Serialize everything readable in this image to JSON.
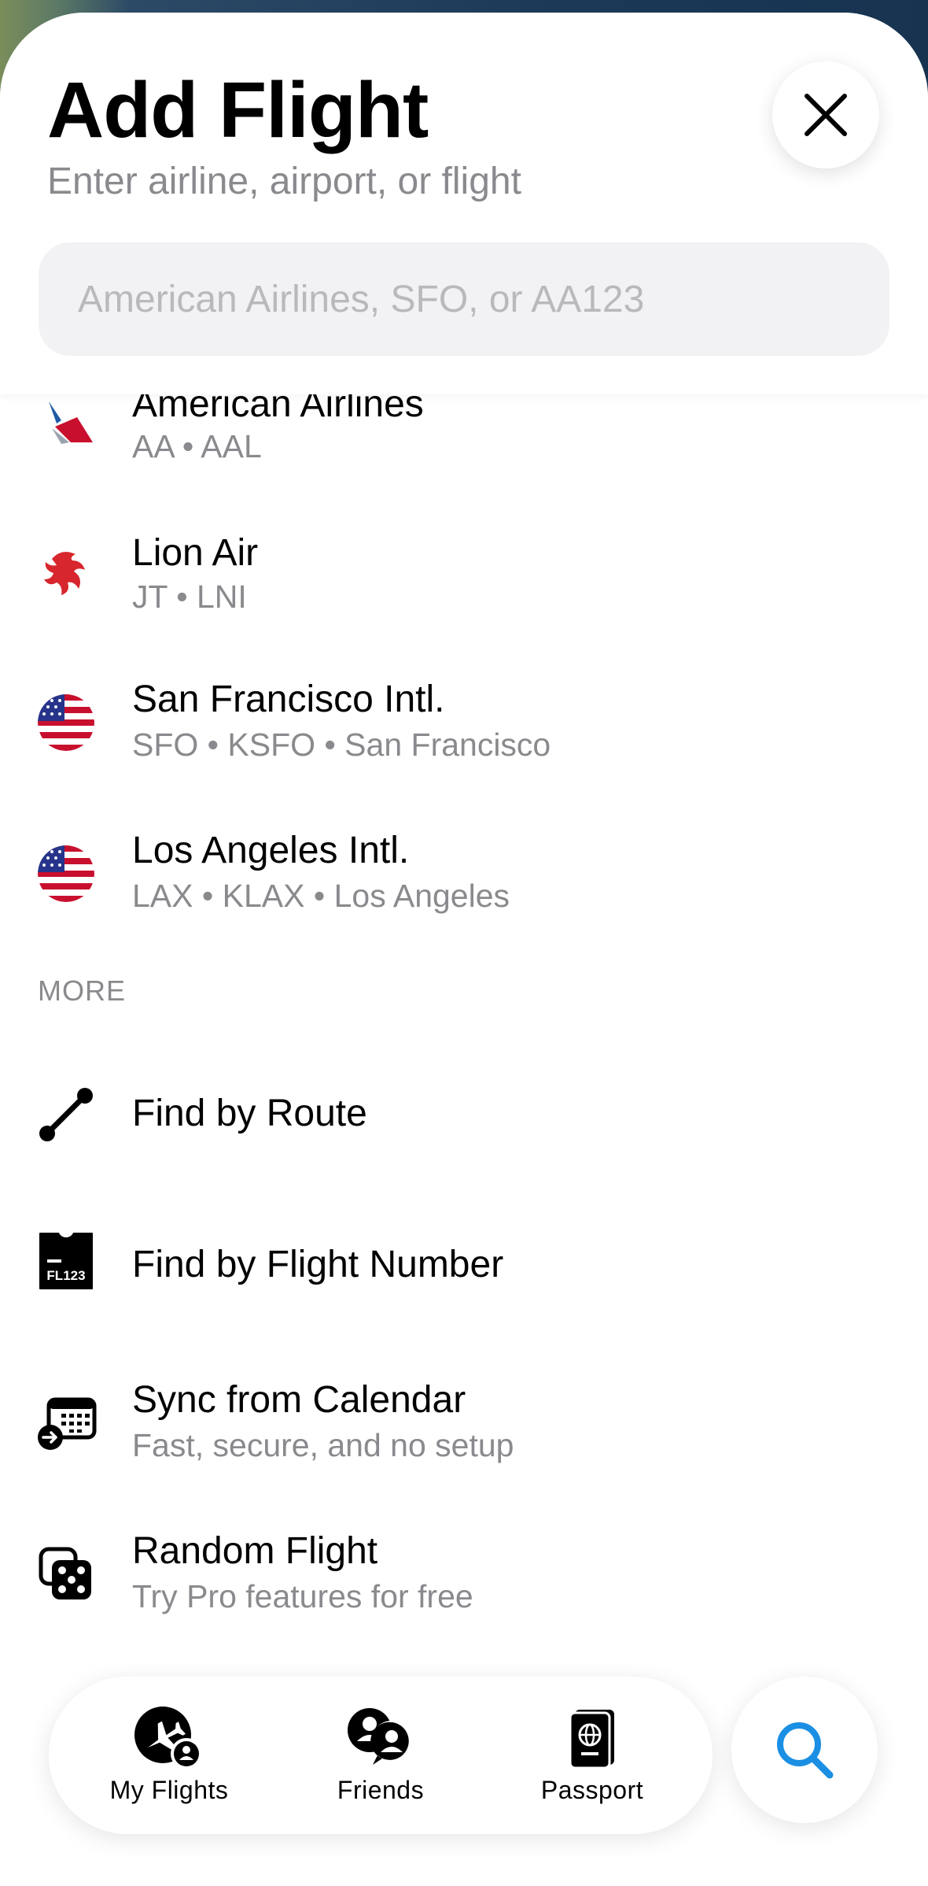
{
  "header": {
    "title": "Add Flight",
    "subtitle": "Enter airline, airport, or flight"
  },
  "search": {
    "placeholder": "American Airlines, SFO, or AA123",
    "value": ""
  },
  "results": [
    {
      "title": "American Airlines",
      "sub": "AA • AAL",
      "icon": "american-airlines-logo"
    },
    {
      "title": "Lion Air",
      "sub": "JT • LNI",
      "icon": "lion-air-logo"
    },
    {
      "title": "San Francisco Intl.",
      "sub": "SFO • KSFO • San Francisco",
      "icon": "us-flag-icon"
    },
    {
      "title": "Los Angeles Intl.",
      "sub": "LAX • KLAX • Los Angeles",
      "icon": "us-flag-icon"
    }
  ],
  "more": {
    "label": "MORE",
    "items": [
      {
        "title": "Find by Route",
        "sub": "",
        "icon": "route-icon"
      },
      {
        "title": "Find by Flight Number",
        "sub": "",
        "icon": "flight-number-ticket-icon",
        "badge": "FL123"
      },
      {
        "title": "Sync from Calendar",
        "sub": "Fast, secure, and no setup",
        "icon": "calendar-sync-icon"
      },
      {
        "title": "Random Flight",
        "sub": "Try Pro features for free",
        "icon": "dice-icon"
      }
    ]
  },
  "tabs": [
    {
      "label": "My Flights",
      "icon": "plane-person-icon"
    },
    {
      "label": "Friends",
      "icon": "friends-icon"
    },
    {
      "label": "Passport",
      "icon": "passport-icon"
    }
  ],
  "colors": {
    "accent": "#1a8fe3",
    "secondary_text": "#8a8a8e",
    "us_flag_red": "#c8102e",
    "us_flag_blue": "#27348b"
  }
}
